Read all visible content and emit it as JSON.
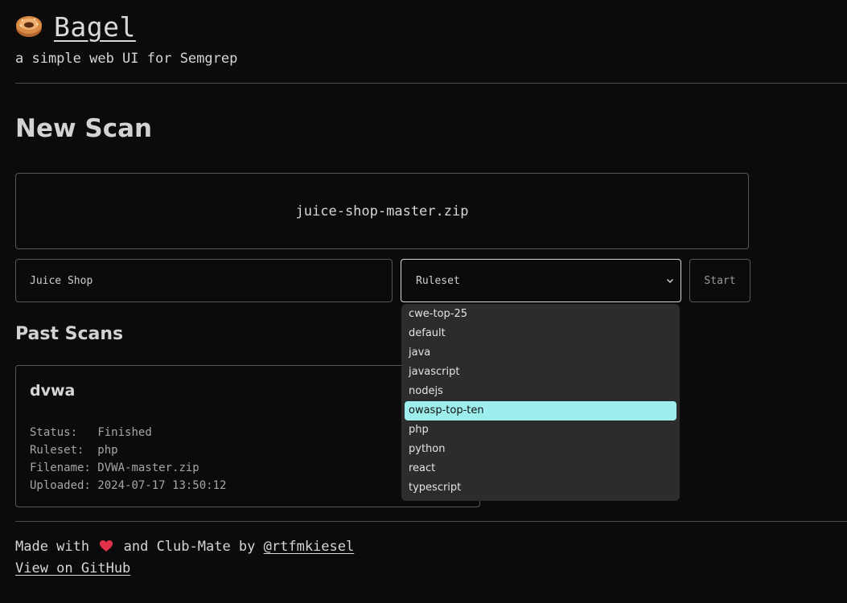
{
  "header": {
    "title": "Bagel",
    "subtitle": "a simple web UI for Semgrep",
    "icon": "bagel-icon"
  },
  "new_scan": {
    "heading": "New Scan",
    "upload_filename": "juice-shop-master.zip",
    "scan_name_value": "Juice Shop",
    "ruleset": {
      "selected_label": "Ruleset",
      "options": [
        "cwe-top-25",
        "default",
        "java",
        "javascript",
        "nodejs",
        "owasp-top-ten",
        "php",
        "python",
        "react",
        "typescript"
      ],
      "highlighted": "owasp-top-ten"
    },
    "start_label": "Start"
  },
  "past_scans": {
    "heading": "Past Scans",
    "items": [
      {
        "name": "dvwa",
        "status_label": "Status:",
        "status": "Finished",
        "ruleset_label": "Ruleset:",
        "ruleset": "php",
        "filename_label": "Filename:",
        "filename": "DVWA-master.zip",
        "uploaded_label": "Uploaded:",
        "uploaded": "2024-07-17 13:50:12"
      }
    ]
  },
  "footer": {
    "made_with": "Made with",
    "and_text": "and Club-Mate by",
    "author_link": "@rtfmkiesel",
    "github_link": "View on GitHub"
  },
  "colors": {
    "background": "#0b0b0b",
    "text": "#d6d6d6",
    "border": "#575757",
    "dropdown_bg": "#2c2c2c",
    "highlight": "#9eeeee",
    "heart": "#e0334a"
  }
}
